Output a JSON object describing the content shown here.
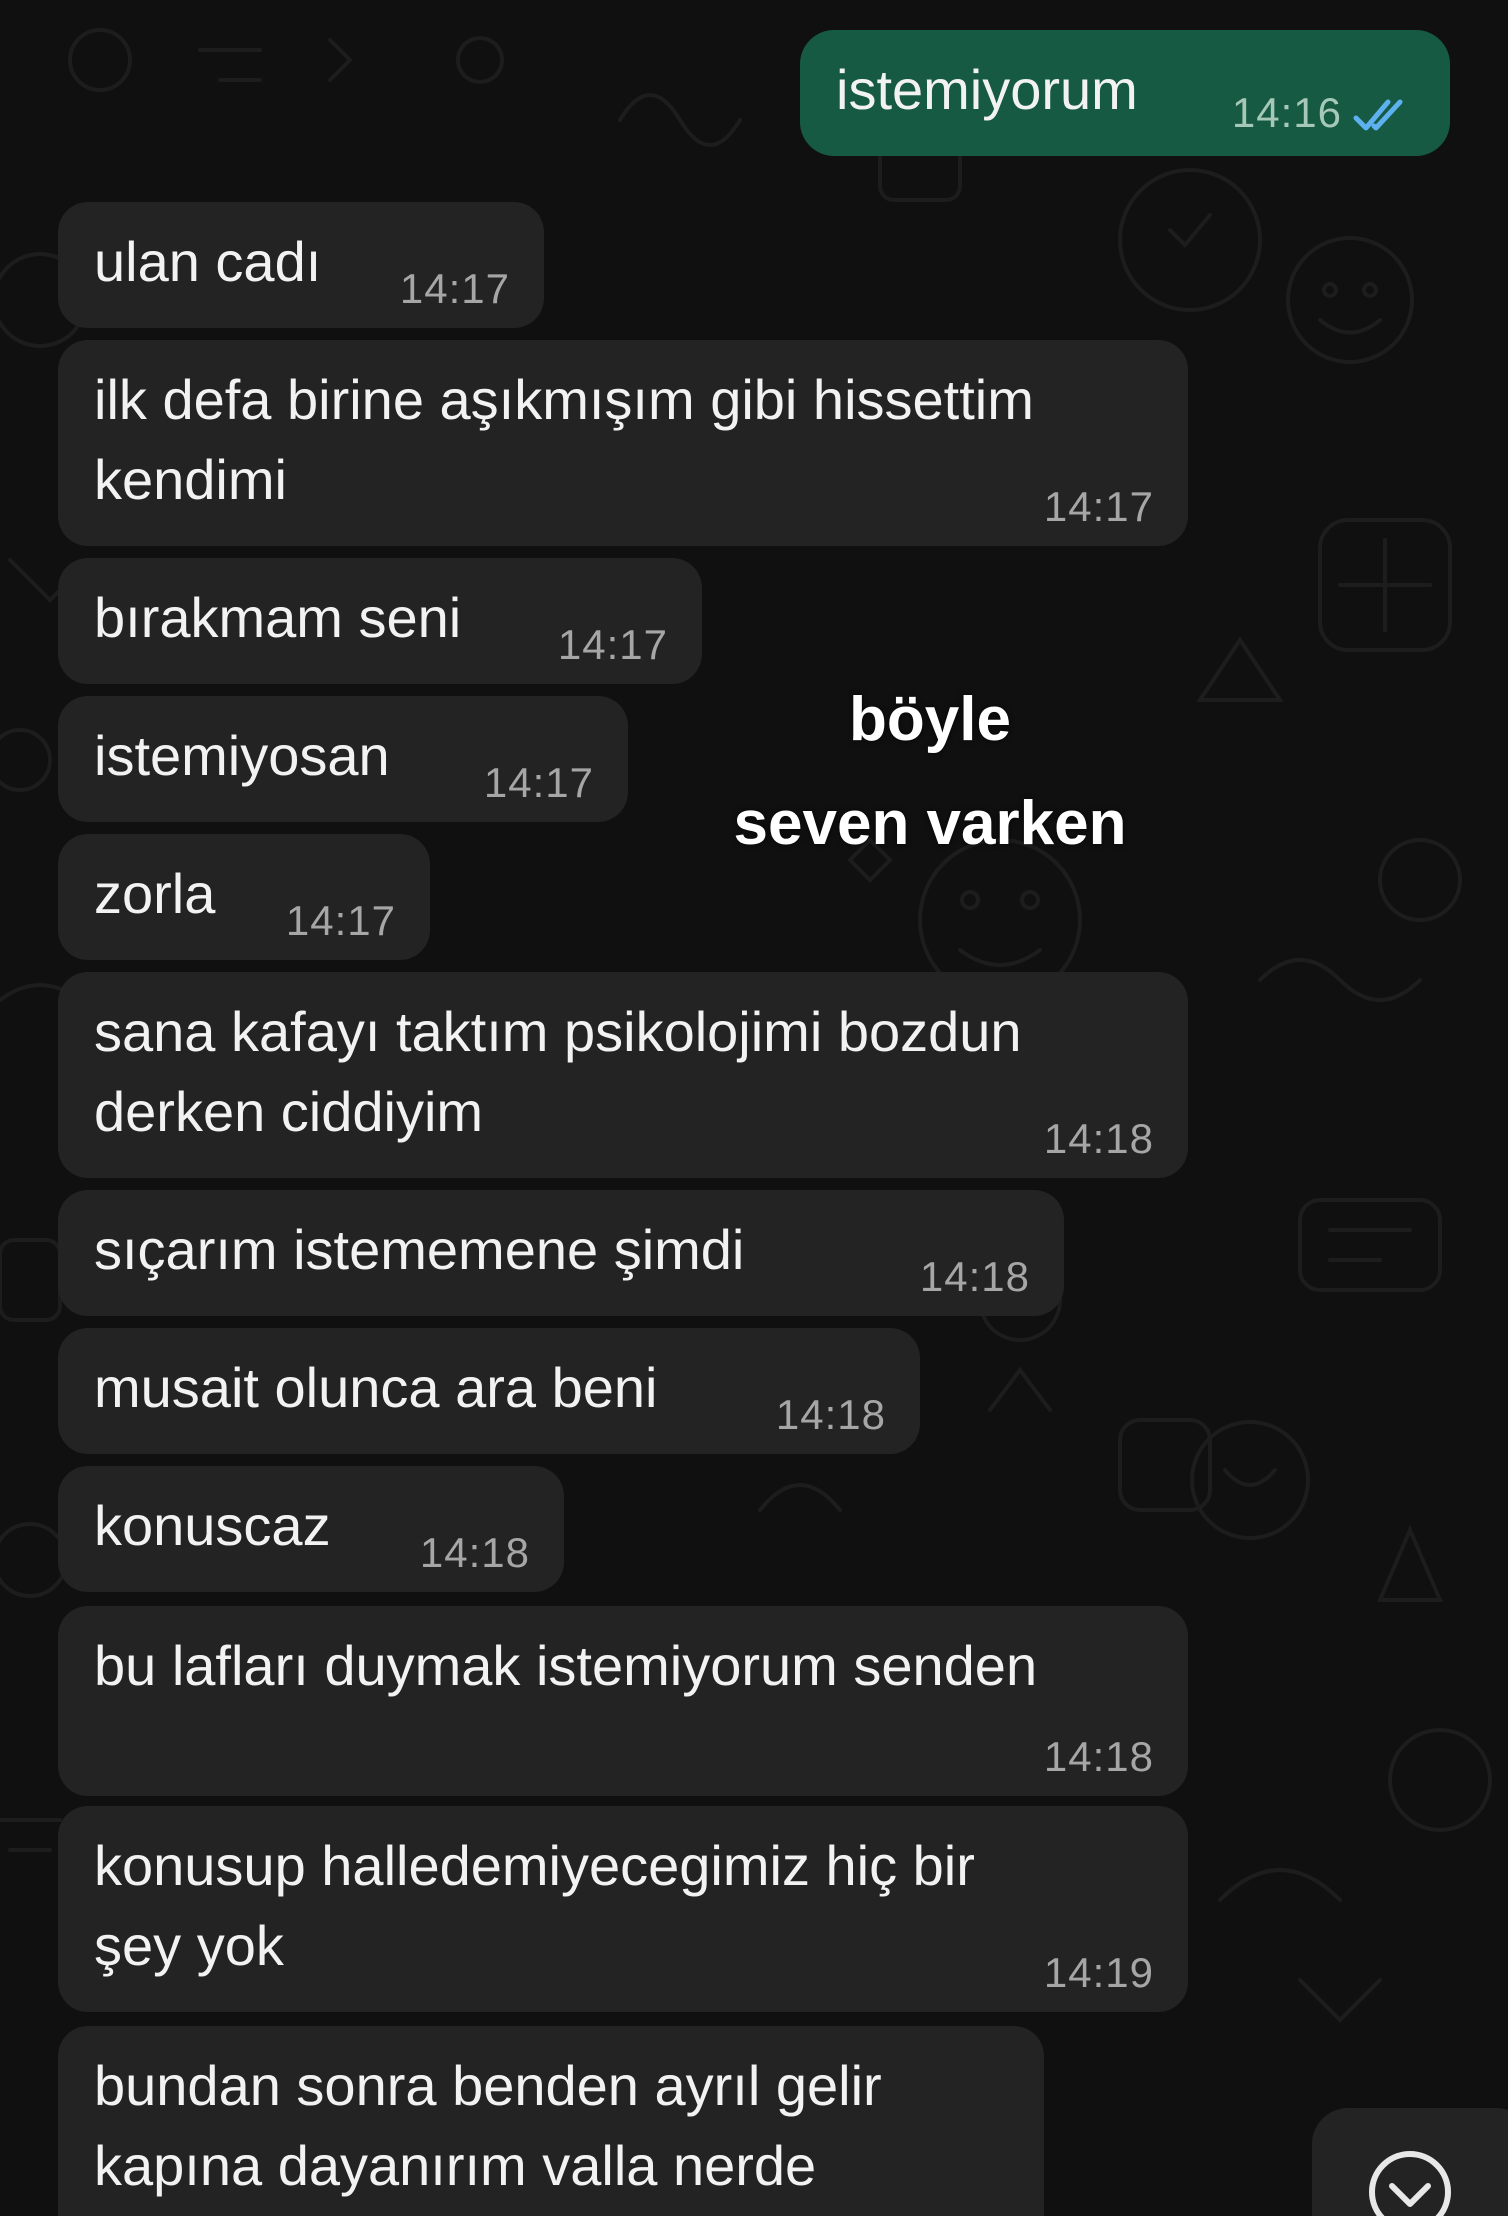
{
  "colors": {
    "background": "#101010",
    "incoming_bubble": "#232324",
    "outgoing_bubble": "#165a43",
    "time_text": "#a6a6a6",
    "read_ticks": "#5eb1ef"
  },
  "messages": [
    {
      "direction": "outgoing",
      "text": "istemiyorum",
      "time": "14:16",
      "status": "read"
    },
    {
      "direction": "incoming",
      "text": "ulan cadı",
      "time": "14:17"
    },
    {
      "direction": "incoming",
      "text": "ilk defa birine aşıkmışım gibi hissettim\nkendimi",
      "time": "14:17"
    },
    {
      "direction": "incoming",
      "text": "bırakmam seni",
      "time": "14:17"
    },
    {
      "direction": "incoming",
      "text": "istemiyosan",
      "time": "14:17"
    },
    {
      "direction": "incoming",
      "text": "zorla",
      "time": "14:17"
    },
    {
      "direction": "incoming",
      "text": "sana kafayı taktım psikolojimi bozdun\nderken ciddiyim",
      "time": "14:18"
    },
    {
      "direction": "incoming",
      "text": "sıçarım istememene şimdi",
      "time": "14:18"
    },
    {
      "direction": "incoming",
      "text": "musait olunca ara beni",
      "time": "14:18"
    },
    {
      "direction": "incoming",
      "text": "konuscaz",
      "time": "14:18"
    },
    {
      "direction": "incoming",
      "text": "bu lafları duymak istemiyorum senden",
      "time": "14:18"
    },
    {
      "direction": "incoming",
      "text": "konusup halledemiyecegimiz hiç bir\nşey yok",
      "time": "14:19"
    },
    {
      "direction": "incoming",
      "text": "bundan sonra benden ayrıl gelir\nkapına dayanırım valla nerde",
      "time": ""
    }
  ],
  "overlay": {
    "line1": "böyle",
    "line2": "seven varken"
  },
  "icons": {
    "read_status": "double-check-icon",
    "scroll_down": "chevron-down-circle-icon"
  }
}
